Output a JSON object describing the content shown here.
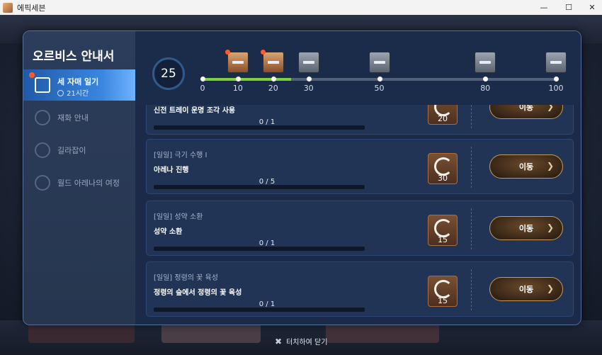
{
  "window": {
    "title": "에픽세븐"
  },
  "panel": {
    "title": "오르비스 안내서"
  },
  "sidebar": {
    "items": [
      {
        "label": "세 자매 일기",
        "sub": "21시간",
        "active": true,
        "icon": "diary-icon"
      },
      {
        "label": "재화 안내",
        "icon": "gear-coin-icon"
      },
      {
        "label": "길라잡이",
        "icon": "compass-icon"
      },
      {
        "label": "월드 아레나의 여정",
        "icon": "globe-icon"
      }
    ]
  },
  "progress": {
    "level": "25",
    "current_points": 25,
    "max_points": 100,
    "milestones": [
      {
        "label": "0",
        "value": 0
      },
      {
        "label": "10",
        "value": 10,
        "chest": "claimable"
      },
      {
        "label": "20",
        "value": 20,
        "chest": "claimable"
      },
      {
        "label": "30",
        "value": 30,
        "chest": "locked"
      },
      {
        "label": "50",
        "value": 50,
        "chest": "locked"
      },
      {
        "label": "80",
        "value": 80,
        "chest": "locked"
      },
      {
        "label": "100",
        "value": 100,
        "chest": "locked"
      }
    ]
  },
  "quests": [
    {
      "category": "",
      "name": "신전 트레이 운명 조각 사용",
      "count": "0 / 1",
      "progress": 0,
      "reward": "20",
      "button": "이동"
    },
    {
      "category": "[일일] 극기 수행 I",
      "name": "아레나 진행",
      "count": "0 / 5",
      "progress": 0,
      "reward": "30",
      "button": "이동"
    },
    {
      "category": "[일일] 성약 소환",
      "name": "성약 소환",
      "count": "0 / 1",
      "progress": 0,
      "reward": "15",
      "button": "이동"
    },
    {
      "category": "[일일] 정령의 꽃 육성",
      "name": "정령의 숲에서 정령의 꽃 육성",
      "count": "0 / 1",
      "progress": 0,
      "reward": "15",
      "button": "이동"
    }
  ],
  "footer": {
    "close_label": "터치하여 닫기"
  },
  "colors": {
    "accent": "#3a86e0",
    "progress_fill": "#7bd23a",
    "notify": "#ff5a2a"
  }
}
